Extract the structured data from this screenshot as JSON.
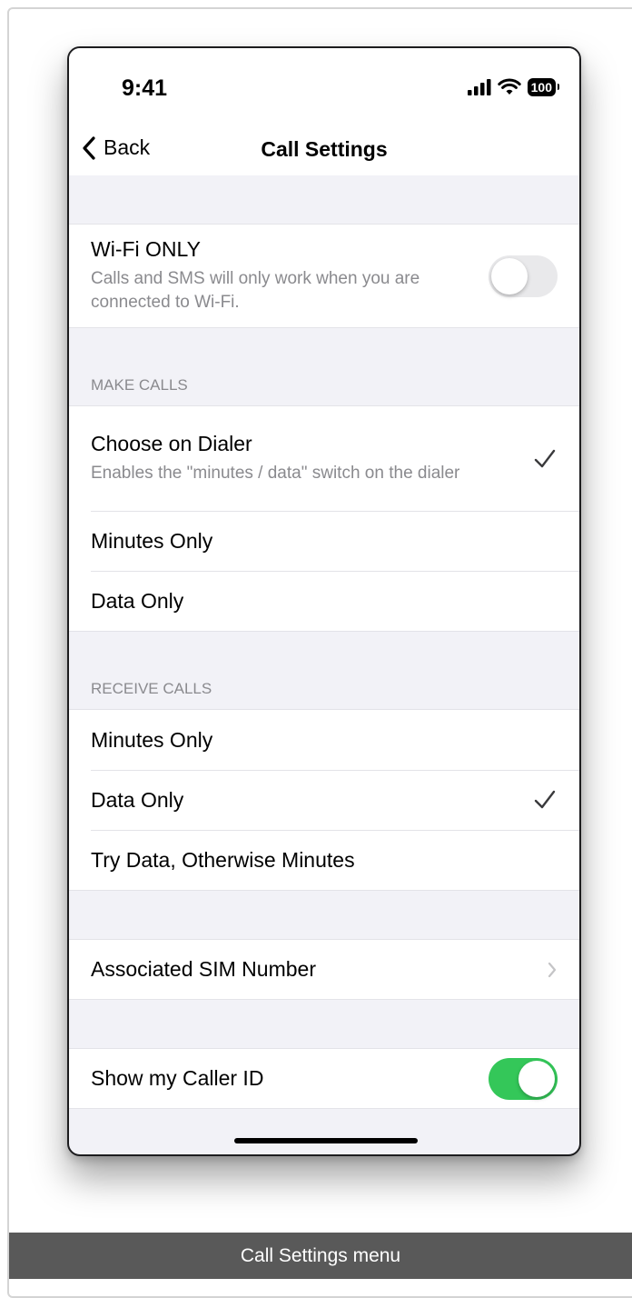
{
  "status_bar": {
    "time": "9:41",
    "battery": "100"
  },
  "nav": {
    "back_label": "Back",
    "title": "Call Settings"
  },
  "wifi_only": {
    "title": "Wi-Fi ONLY",
    "subtitle": "Calls and SMS will only work when you are connected to Wi-Fi.",
    "enabled": false
  },
  "make_calls": {
    "header": "MAKE CALLS",
    "options": [
      {
        "title": "Choose on Dialer",
        "subtitle": "Enables the \"minutes / data\" switch on the dialer",
        "selected": true
      },
      {
        "title": "Minutes Only",
        "selected": false
      },
      {
        "title": "Data Only",
        "selected": false
      }
    ]
  },
  "receive_calls": {
    "header": "RECEIVE CALLS",
    "options": [
      {
        "title": "Minutes Only",
        "selected": false
      },
      {
        "title": "Data Only",
        "selected": true
      },
      {
        "title": "Try Data, Otherwise Minutes",
        "selected": false
      }
    ]
  },
  "sim": {
    "title": "Associated SIM Number"
  },
  "caller_id": {
    "title": "Show my Caller ID",
    "enabled": true
  },
  "colors": {
    "toggle_on": "#34c759",
    "toggle_off": "#e9e9eb",
    "secondary_text": "#8a8a8e",
    "background": "#f2f2f7"
  },
  "caption": "Call Settings menu"
}
